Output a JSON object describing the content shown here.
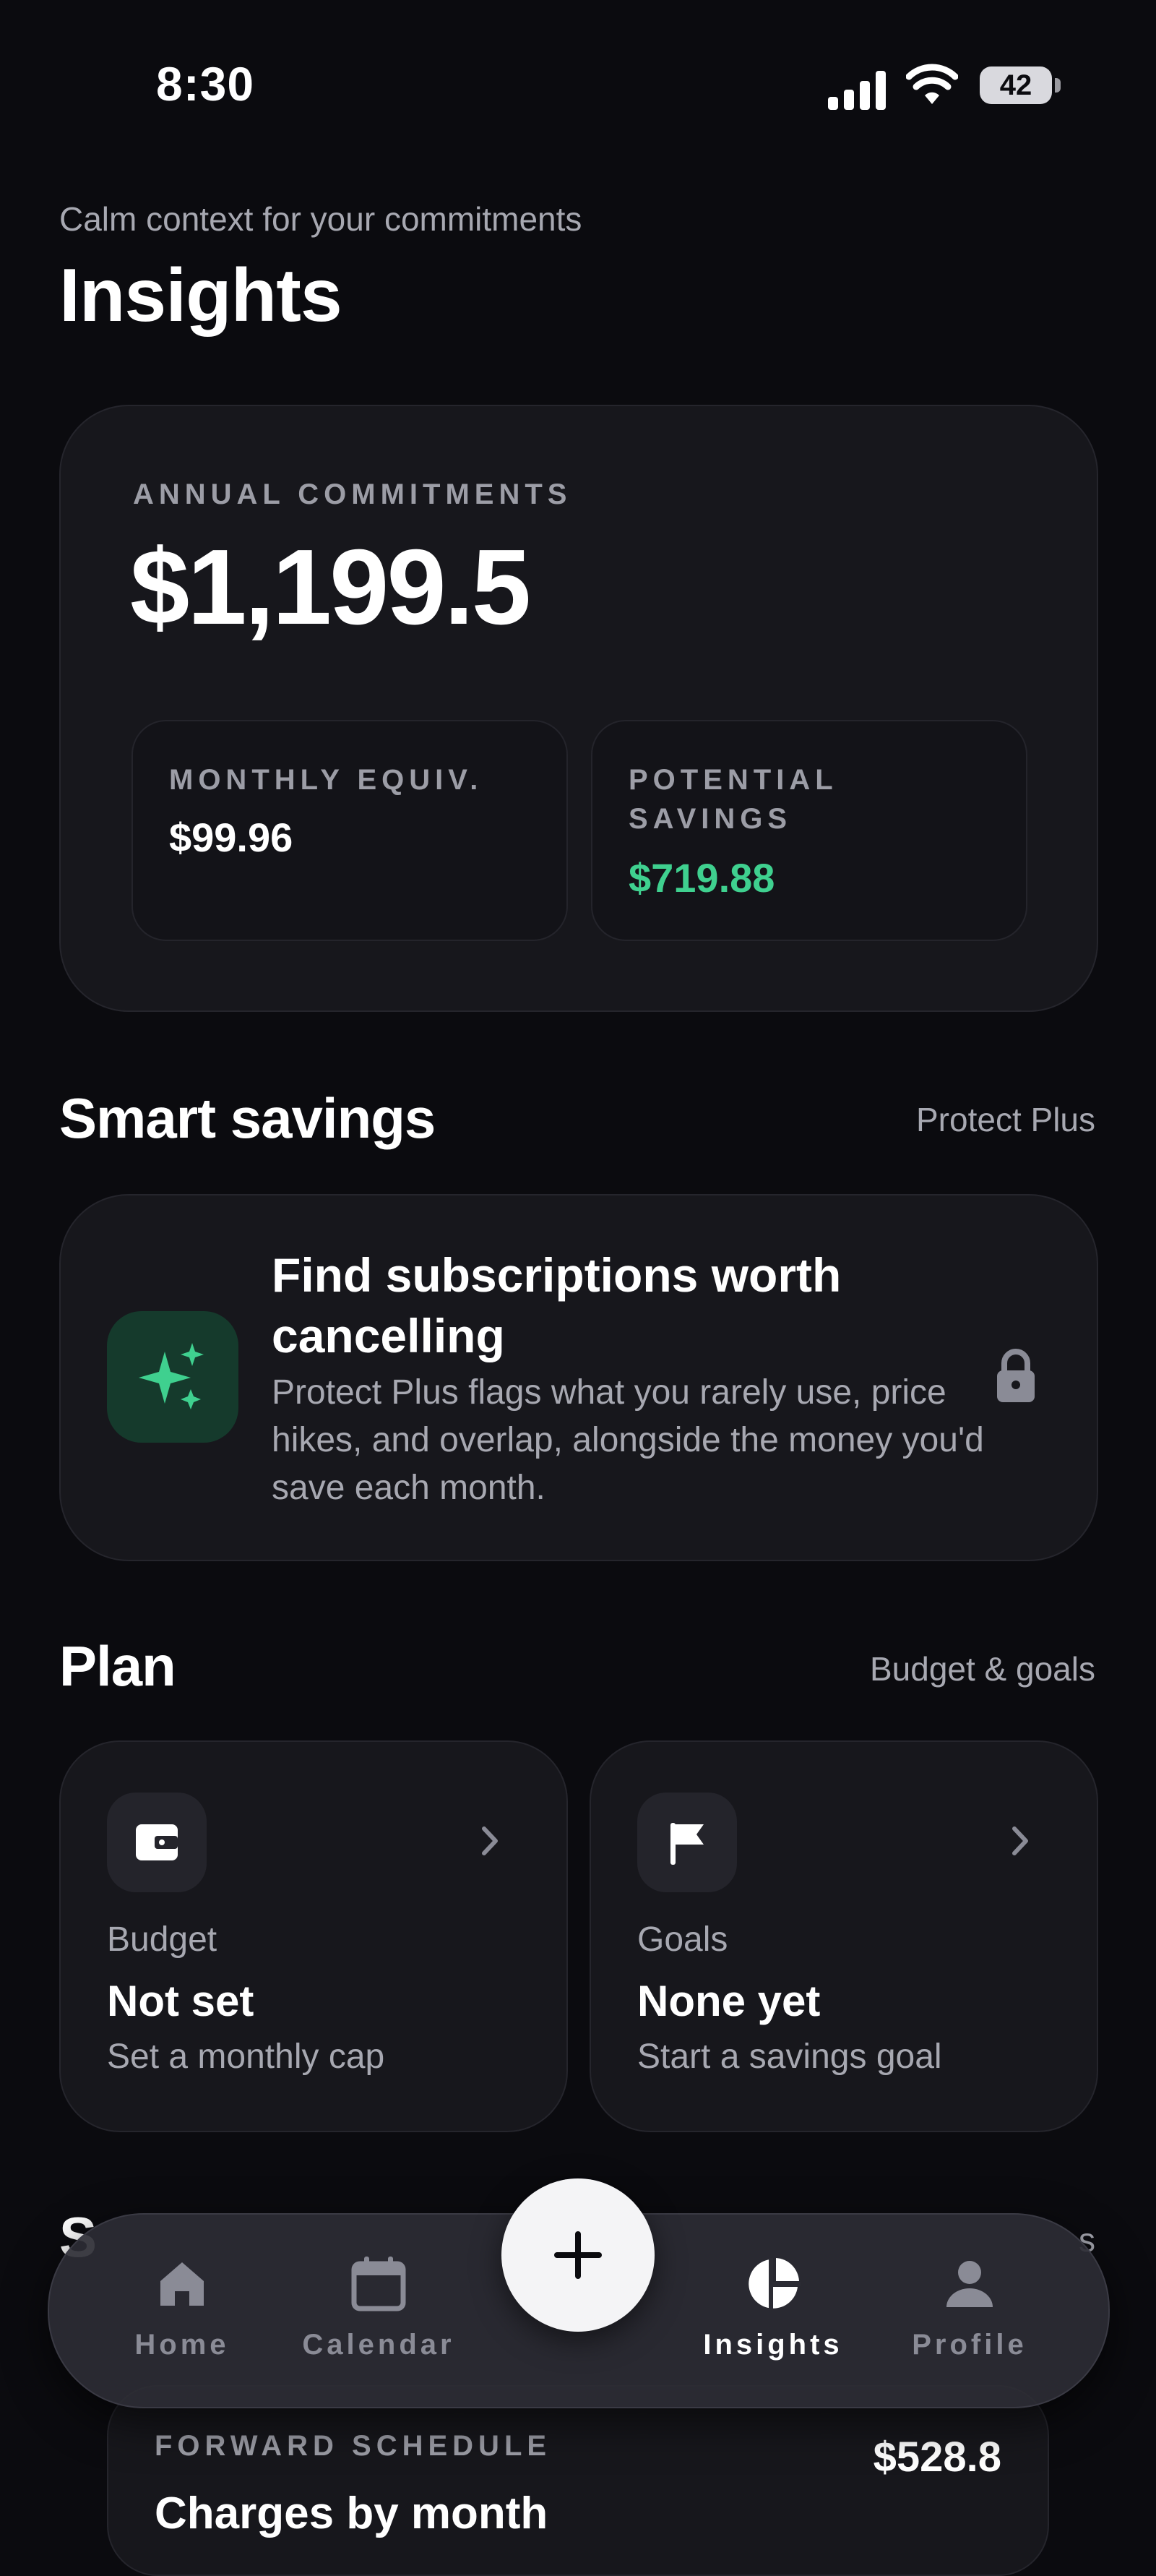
{
  "status_bar": {
    "time": "8:30",
    "battery": "42"
  },
  "header": {
    "subtitle": "Calm context for your commitments",
    "title": "Insights"
  },
  "summary": {
    "annual_label": "ANNUAL COMMITMENTS",
    "annual_value": "$1,199.5",
    "monthly_label": "MONTHLY EQUIV.",
    "monthly_value": "$99.96",
    "savings_label": "POTENTIAL SAVINGS",
    "savings_value": "$719.88",
    "accent_color": "#3fd08f"
  },
  "smart_savings": {
    "title": "Smart savings",
    "link": "Protect Plus",
    "card_title": "Find subscriptions worth cancelling",
    "card_desc": "Protect Plus flags what you rarely use, price hikes, and overlap, alongside the money you'd save each month.",
    "icon": "sparkle-icon",
    "lock_icon": "lock-icon"
  },
  "plan": {
    "title": "Plan",
    "link": "Budget & goals",
    "budget": {
      "kicker": "Budget",
      "value": "Not set",
      "sub": "Set a monthly cap",
      "icon": "wallet-icon"
    },
    "goals": {
      "kicker": "Goals",
      "value": "None yet",
      "sub": "Start a savings goal",
      "icon": "flag-icon"
    }
  },
  "schedule": {
    "title_partial": "S",
    "link_partial": "s",
    "label": "FORWARD SCHEDULE",
    "value": "$528.8",
    "heading": "Charges by month"
  },
  "tabbar": {
    "home": "Home",
    "calendar": "Calendar",
    "insights": "Insights",
    "profile": "Profile",
    "add_icon": "plus-icon"
  }
}
